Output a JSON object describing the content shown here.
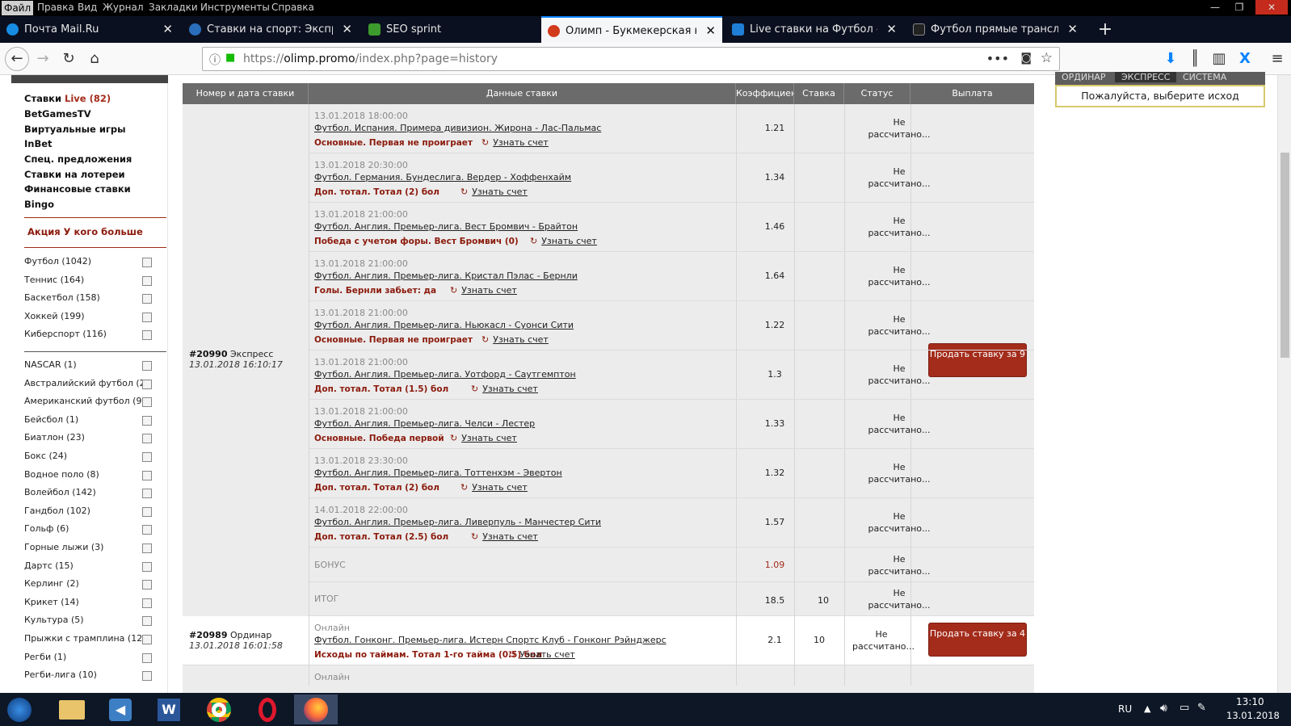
{
  "menubar": {
    "items": [
      "Файл",
      "Правка",
      "Вид",
      "Журнал",
      "Закладки",
      "Инструменты",
      "Справка"
    ]
  },
  "window_controls": {
    "minimize": "—",
    "maximize": "❐",
    "close": "✕"
  },
  "tabs": [
    {
      "title": "Почта Mail.Ru",
      "icon": "mailru-icon",
      "color": "#168de2"
    },
    {
      "title": "Ставки на спорт: Экспресс , О",
      "icon": "bookmaker-icon",
      "color": "#2a6ebb"
    },
    {
      "title": "SEO sprint",
      "icon": "seosprint-icon",
      "color": "#3d9b2d"
    },
    {
      "title": "Олимп - Букмекерская конто",
      "icon": "olimp-icon",
      "color": "#d23a1c",
      "active": true
    },
    {
      "title": "Live ставки на Футбол - сдела",
      "icon": "live-icon",
      "color": "#1f7fd6"
    },
    {
      "title": "Футбол прямые трансляции -",
      "icon": "broadcast-icon",
      "color": "#222222"
    }
  ],
  "newtab": "+",
  "address": {
    "prefix": "https://",
    "host": "olimp.promo",
    "path": "/index.php?page=history"
  },
  "sidebar": {
    "links": [
      {
        "label": "Ставки ",
        "highlight": "Live (82)"
      },
      {
        "label": "BetGamesTV"
      },
      {
        "label": "Виртуальные игры"
      },
      {
        "label": "InBet"
      },
      {
        "label": "Спец. предложения"
      },
      {
        "label": "Ставки на лотереи"
      },
      {
        "label": "Финансовые ставки"
      },
      {
        "label": "Bingo"
      }
    ],
    "promo": "Акция У кого больше",
    "sports_top": [
      "Футбол (1042)",
      "Теннис (164)",
      "Баскетбол (158)",
      "Хоккей (199)",
      "Киберспорт (116)"
    ],
    "sports": [
      "NASCAR (1)",
      "Австралийский футбол (2)",
      "Американский футбол (9)",
      "Бейсбол (1)",
      "Биатлон (23)",
      "Бокс (24)",
      "Водное поло (8)",
      "Волейбол (142)",
      "Гандбол (102)",
      "Гольф (6)",
      "Горные лыжи (3)",
      "Дартс (15)",
      "Керлинг (2)",
      "Крикет (14)",
      "Культура (5)",
      "Прыжки с трамплина (12)",
      "Регби (1)",
      "Регби-лига (10)"
    ]
  },
  "table": {
    "headers": [
      "Номер и дата ставки",
      "Данные ставки",
      "Коэффициент",
      "Ставка",
      "Статус",
      "Выплата"
    ],
    "express": {
      "num": "#20990",
      "type": " Экспресс",
      "time": "13.01.2018 16:10:17",
      "sell": "Продать ставку за 9",
      "rows": [
        {
          "date": "13.01.2018 18:00:00",
          "event": "Футбол. Испания. Примера дивизион. Жирона - Лас-Пальмас",
          "market": "Основные. Первая не проиграет",
          "score": "Узнать счет",
          "k": "1.21",
          "status": "Не рассчитано..."
        },
        {
          "date": "13.01.2018 20:30:00",
          "event": "Футбол. Германия. Бундеслига. Вердер - Хоффенхайм",
          "market": "Доп. тотал. Тотал (2) бол",
          "score": "Узнать счет",
          "k": "1.34",
          "status": "Не рассчитано..."
        },
        {
          "date": "13.01.2018 21:00:00",
          "event": "Футбол. Англия. Премьер-лига. Вест Бромвич - Брайтон",
          "market": "Победа с учетом форы. Вест Бромвич (0)",
          "score": "Узнать счет",
          "k": "1.46",
          "status": "Не рассчитано..."
        },
        {
          "date": "13.01.2018 21:00:00",
          "event": "Футбол. Англия. Премьер-лига. Кристал Пэлас - Бернли",
          "market": "Голы. Бернли забьет: да",
          "score": "Узнать счет",
          "k": "1.64",
          "status": "Не рассчитано..."
        },
        {
          "date": "13.01.2018 21:00:00",
          "event": "Футбол. Англия. Премьер-лига. Ньюкасл - Суонси Сити",
          "market": "Основные. Первая не проиграет",
          "score": "Узнать счет",
          "k": "1.22",
          "status": "Не рассчитано..."
        },
        {
          "date": "13.01.2018 21:00:00",
          "event": "Футбол. Англия. Премьер-лига. Уотфорд - Саутгемптон",
          "market": "Доп. тотал. Тотал (1.5) бол",
          "score": "Узнать счет",
          "k": "1.3",
          "status": "Не рассчитано..."
        },
        {
          "date": "13.01.2018 21:00:00",
          "event": "Футбол. Англия. Премьер-лига. Челси - Лестер",
          "market": "Основные. Победа первой",
          "score": "Узнать счет",
          "k": "1.33",
          "status": "Не рассчитано..."
        },
        {
          "date": "13.01.2018 23:30:00",
          "event": "Футбол. Англия. Премьер-лига. Тоттенхэм - Эвертон",
          "market": "Доп. тотал. Тотал (2) бол",
          "score": "Узнать счет",
          "k": "1.32",
          "status": "Не рассчитано..."
        },
        {
          "date": "14.01.2018 22:00:00",
          "event": "Футбол. Англия. Премьер-лига. Ливерпуль - Манчестер Сити",
          "market": "Доп. тотал. Тотал (2.5) бол",
          "score": "Узнать счет",
          "k": "1.57",
          "status": "Не рассчитано..."
        }
      ],
      "bonus": {
        "label": "БОНУС",
        "k": "1.09",
        "status": "Не рассчитано..."
      },
      "total": {
        "label": "ИТОГ",
        "k": "18.5",
        "stake": "10",
        "status": "Не рассчитано..."
      }
    },
    "single": {
      "num": "#20989",
      "type": " Ординар",
      "time": "13.01.2018 16:01:58",
      "mode": "Онлайн",
      "event": "Футбол. Гонконг. Премьер-лига. Истерн Спортс Клуб - Гонконг Рэйнджерс",
      "market": "Исходы по таймам. Тотал 1-го тайма (0.5) бол",
      "score": "Узнать счет",
      "k": "2.1",
      "stake": "10",
      "status": "Не рассчитано...",
      "sell": "Продать ставку за 4"
    },
    "next_mode": "Онлайн"
  },
  "coupon": {
    "tabs": [
      "ОРДИНАР",
      "ЭКСПРЕСС",
      "СИСТЕМА"
    ],
    "message": "Пожалуйста, выберите исход"
  },
  "taskbar": {
    "lang": "RU",
    "time": "13:10",
    "date": "13.01.2018"
  },
  "colors": {
    "accent": "#a32c1b",
    "header": "#6b6b6b",
    "taskbar": "#0e1726"
  }
}
